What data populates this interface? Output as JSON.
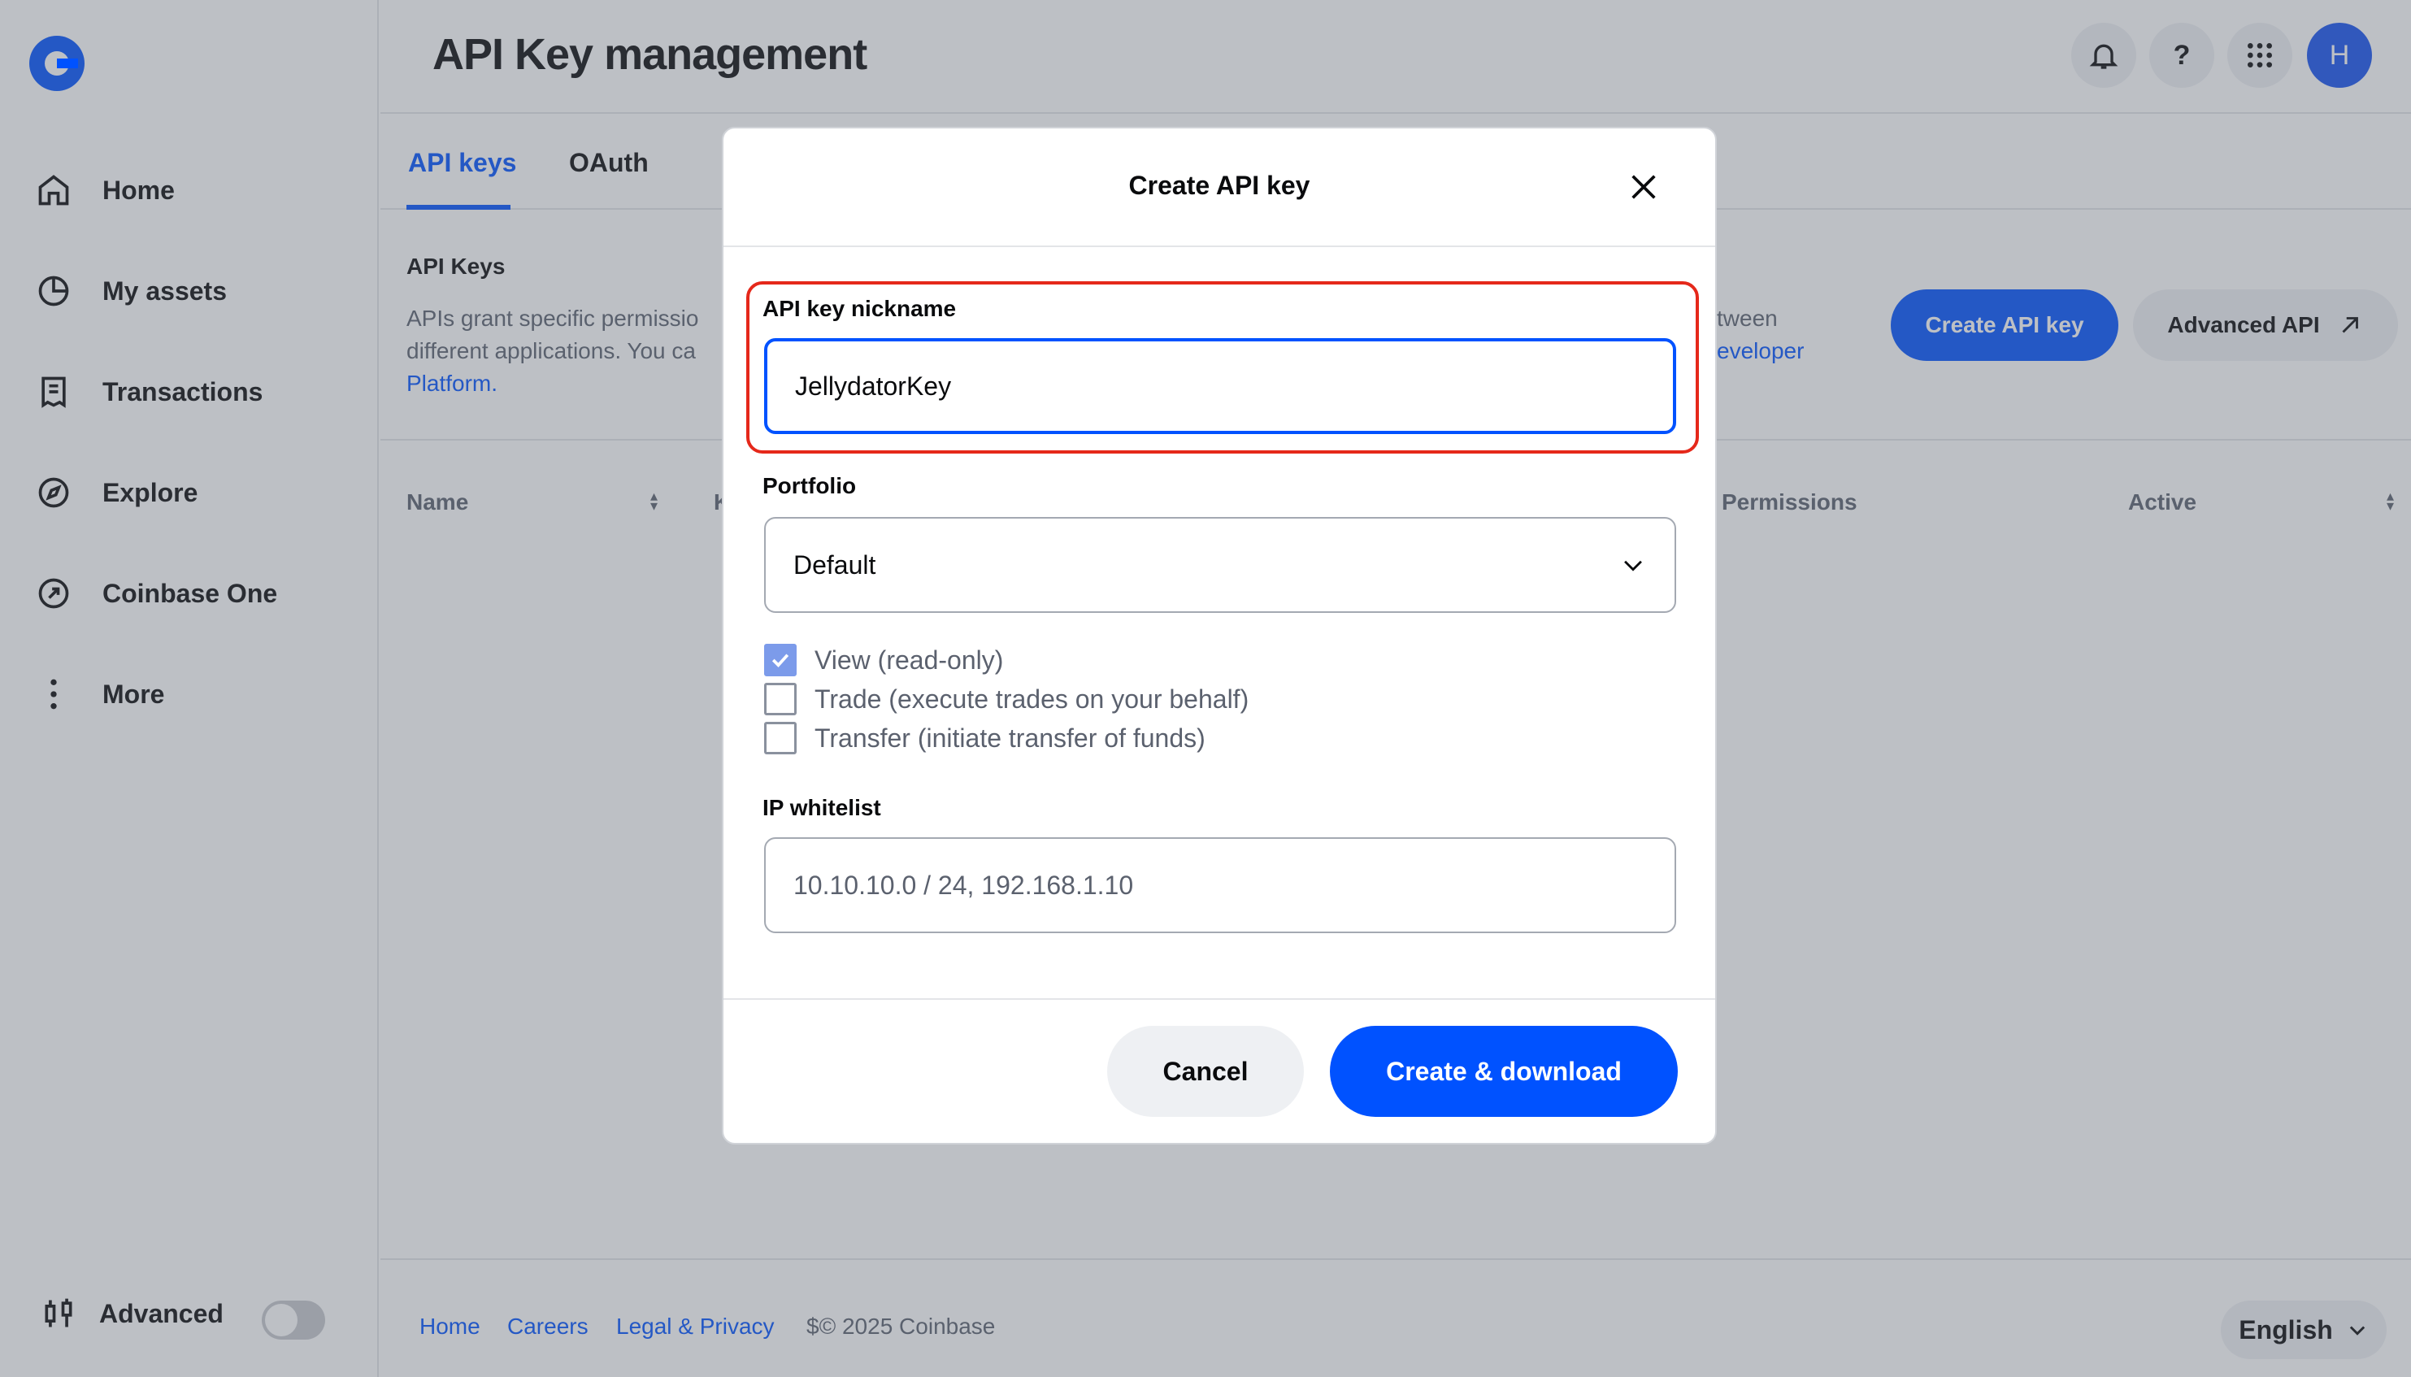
{
  "page": {
    "title": "API Key management"
  },
  "sidebar": {
    "items": [
      {
        "label": "Home",
        "icon": "home-icon"
      },
      {
        "label": "My assets",
        "icon": "pie-chart-icon"
      },
      {
        "label": "Transactions",
        "icon": "receipt-icon"
      },
      {
        "label": "Explore",
        "icon": "compass-icon"
      },
      {
        "label": "Coinbase One",
        "icon": "coinbase-one-icon"
      },
      {
        "label": "More",
        "icon": "more-vertical-icon"
      }
    ],
    "advanced_label": "Advanced"
  },
  "header": {
    "avatar_initial": "H",
    "help_glyph": "?"
  },
  "tabs": [
    {
      "label": "API keys",
      "active": true
    },
    {
      "label": "OAuth",
      "active": false
    }
  ],
  "section": {
    "title": "API Keys",
    "desc_line1": "APIs grant specific permissio",
    "desc_line2": "different applications. You ca",
    "desc_link": "Platform.",
    "desc_right_line1": "tween",
    "desc_right_link": "eveloper",
    "create_button": "Create API key",
    "advanced_button": "Advanced API"
  },
  "table": {
    "columns": [
      "Name",
      "K",
      "Permissions",
      "Active"
    ]
  },
  "footer": {
    "links": [
      "Home",
      "Careers",
      "Legal & Privacy"
    ],
    "copyright": "$© 2025 Coinbase",
    "language": "English"
  },
  "modal": {
    "title": "Create API key",
    "nickname_label": "API key nickname",
    "nickname_value": "JellydatorKey",
    "portfolio_label": "Portfolio",
    "portfolio_value": "Default",
    "permissions": [
      {
        "label": "View (read-only)",
        "checked": true
      },
      {
        "label": "Trade (execute trades on your behalf)",
        "checked": false
      },
      {
        "label": "Transfer (initiate transfer of funds)",
        "checked": false
      }
    ],
    "ip_label": "IP whitelist",
    "ip_placeholder": "10.10.10.0 / 24, 192.168.1.10",
    "cancel_button": "Cancel",
    "create_button": "Create & download"
  },
  "colors": {
    "brand": "#0052ff",
    "highlight": "#e5281a"
  }
}
